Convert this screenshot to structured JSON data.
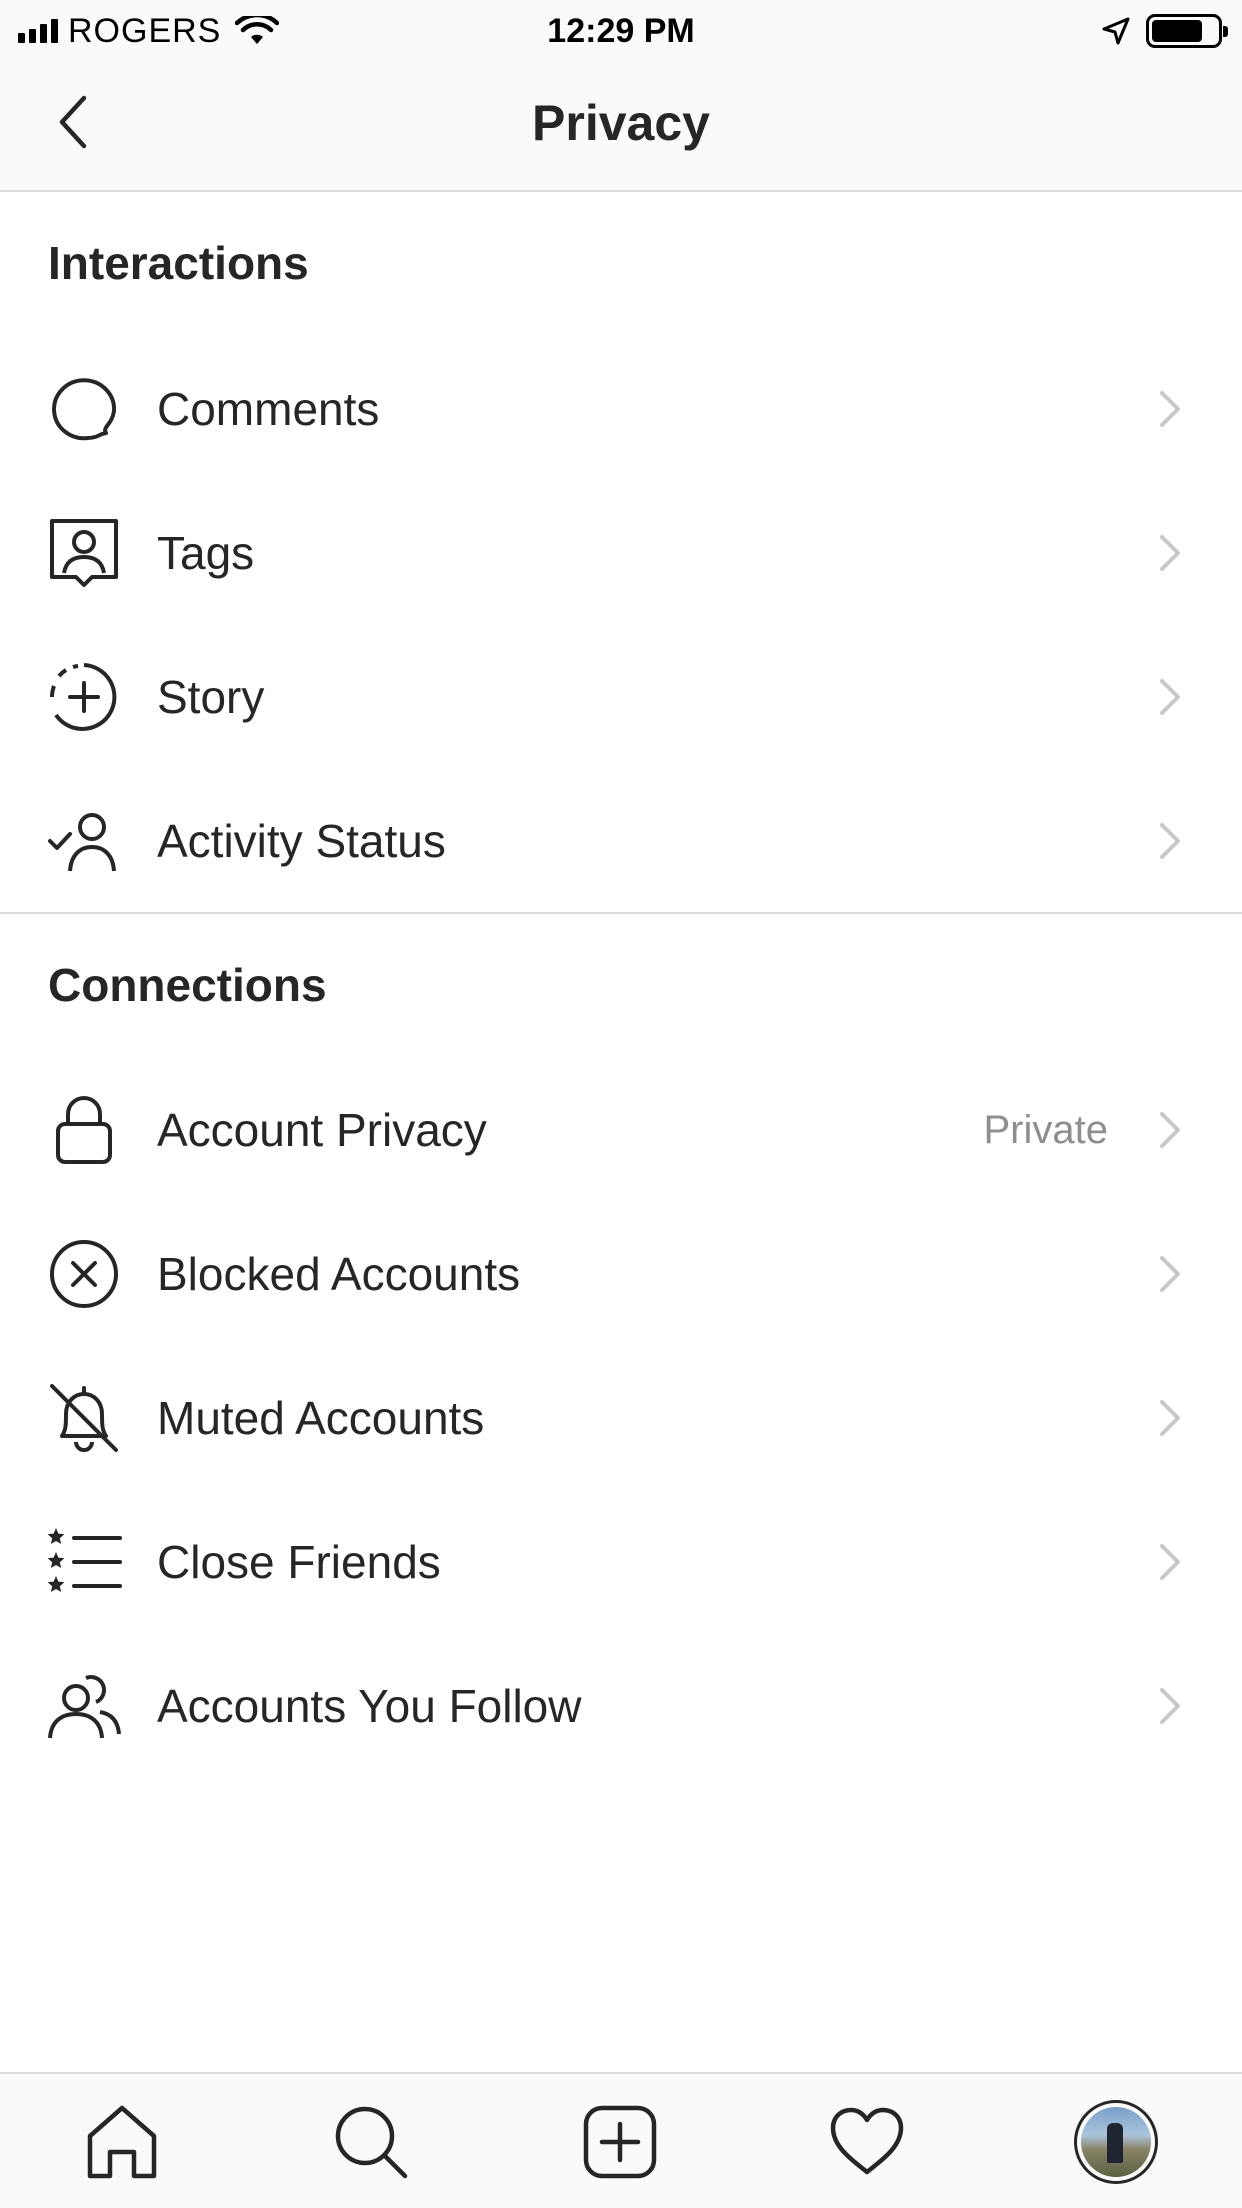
{
  "status_bar": {
    "carrier": "ROGERS",
    "time": "12:29 PM",
    "battery_level": 0.78
  },
  "header": {
    "title": "Privacy",
    "back_icon": "chevron-left-icon"
  },
  "sections": {
    "interactions": {
      "title": "Interactions",
      "items": [
        {
          "label": "Comments",
          "icon": "comment-bubble-icon"
        },
        {
          "label": "Tags",
          "icon": "tag-person-icon"
        },
        {
          "label": "Story",
          "icon": "story-plus-icon"
        },
        {
          "label": "Activity Status",
          "icon": "activity-status-icon"
        }
      ]
    },
    "connections": {
      "title": "Connections",
      "items": [
        {
          "label": "Account Privacy",
          "value": "Private",
          "icon": "lock-icon"
        },
        {
          "label": "Blocked Accounts",
          "icon": "blocked-circle-x-icon"
        },
        {
          "label": "Muted Accounts",
          "icon": "muted-bell-icon"
        },
        {
          "label": "Close Friends",
          "icon": "star-list-icon"
        },
        {
          "label": "Accounts You Follow",
          "icon": "people-icon"
        }
      ]
    }
  },
  "tab_bar": {
    "items": [
      {
        "icon": "home-icon"
      },
      {
        "icon": "search-icon"
      },
      {
        "icon": "add-post-icon"
      },
      {
        "icon": "heart-icon"
      },
      {
        "icon": "profile-avatar"
      }
    ]
  },
  "colors": {
    "text": "#262626",
    "secondary_text": "#8e8e8e",
    "divider": "#dbdbdb",
    "bar_background": "#fafafa"
  }
}
